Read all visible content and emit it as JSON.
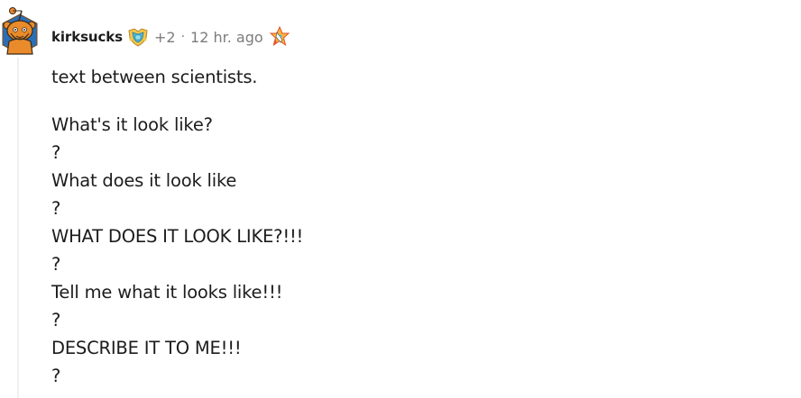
{
  "comment": {
    "author": "kirksucks",
    "award_count": "+2",
    "separator": "·",
    "timestamp": "12 hr. ago",
    "icons": {
      "avatar": "snoo-avatar-icon",
      "award": "award-badge-icon",
      "achievement": "rocket-achievement-icon"
    },
    "body_intro": "text between scientists.",
    "body_lines": [
      "What's it look like?",
      "?",
      "What does it look like",
      "?",
      "WHAT DOES IT LOOK LIKE?!!!",
      "?",
      "Tell me what it looks like!!!",
      "?",
      "DESCRIBE IT TO ME!!!",
      "?"
    ]
  },
  "colors": {
    "text": "#1c1c1c",
    "meta": "#7c7c7c",
    "thread_line": "#edeff1",
    "avatar_bg": "#2a6fb5",
    "snoo_orange": "#e98b2a"
  }
}
